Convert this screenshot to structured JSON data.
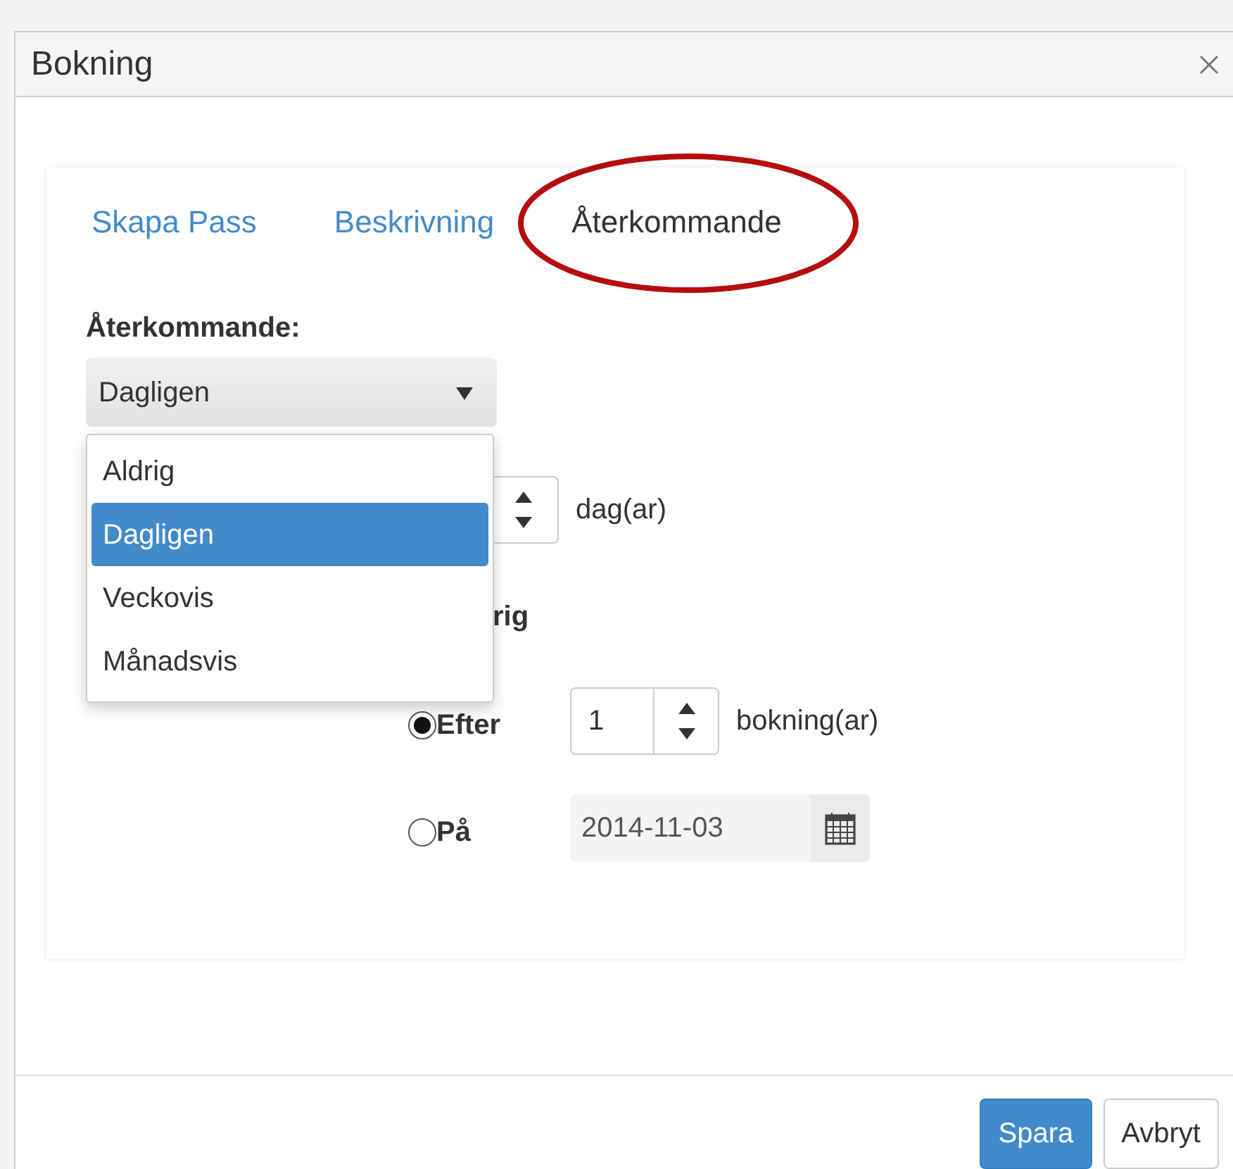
{
  "window": {
    "title": "Bokning"
  },
  "tabs": [
    {
      "label": "Skapa Pass",
      "selected": false
    },
    {
      "label": "Beskrivning",
      "selected": false
    },
    {
      "label": "Återkommande",
      "selected": true
    }
  ],
  "recurrence": {
    "label": "Återkommande:",
    "value": "Dagligen",
    "options": [
      {
        "label": "Aldrig",
        "selected": false
      },
      {
        "label": "Dagligen",
        "selected": true
      },
      {
        "label": "Veckovis",
        "selected": false
      },
      {
        "label": "Månadsvis",
        "selected": false
      }
    ]
  },
  "interval": {
    "unit": "dag(ar)"
  },
  "end": {
    "heading": "rig",
    "options": [
      {
        "kind": "count",
        "label": "Efter",
        "selected": true,
        "value": "1",
        "unit": "bokning(ar)"
      },
      {
        "kind": "date",
        "label": "På",
        "selected": false,
        "value": "2014-11-03"
      }
    ]
  },
  "buttons": [
    {
      "label": "Spara",
      "kind": "primary"
    },
    {
      "label": "Avbryt",
      "kind": "default"
    }
  ]
}
